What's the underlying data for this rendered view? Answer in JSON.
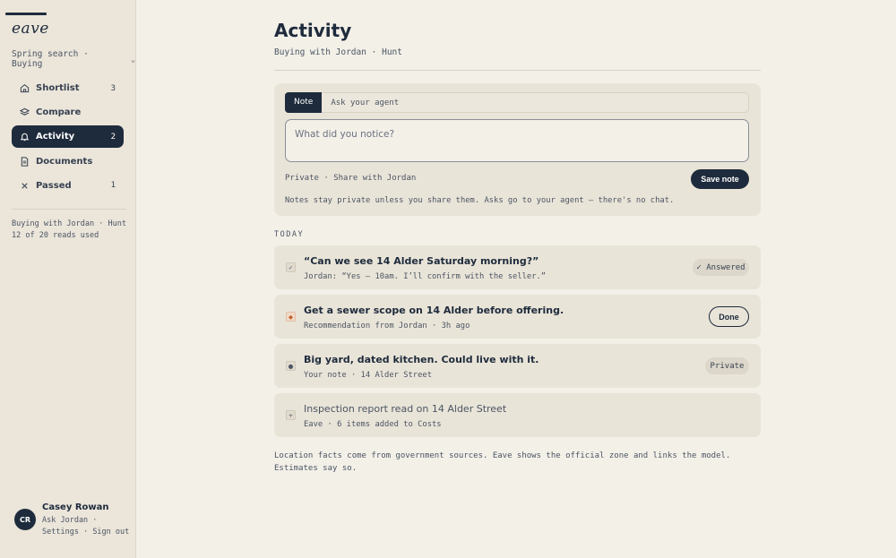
{
  "sidebar": {
    "logo": "eave",
    "context": "Spring search · Buying",
    "nav": [
      {
        "label": "Shortlist",
        "count": "3",
        "icon": "home-icon"
      },
      {
        "label": "Compare",
        "count": "",
        "icon": "layers-icon"
      },
      {
        "label": "Activity",
        "count": "2",
        "icon": "bell-icon",
        "active": true
      },
      {
        "label": "Documents",
        "count": "",
        "icon": "document-icon"
      },
      {
        "label": "Passed",
        "count": "1",
        "icon": "close-icon"
      }
    ],
    "info_line1": "Buying with Jordan · Hunt",
    "info_line2": "12 of 20 reads used",
    "user": {
      "initials": "CR",
      "name": "Casey Rowan",
      "link_ask": "Ask Jordan",
      "link_settings": "Settings",
      "link_signout": "Sign out"
    }
  },
  "main": {
    "title": "Activity",
    "subtitle": "Buying with Jordan · Hunt",
    "composer": {
      "tab_note": "Note",
      "tab_ask": "Ask your agent",
      "placeholder": "What did you notice?",
      "privacy_private": "Private",
      "privacy_share": "Share with Jordan",
      "save_label": "Save note",
      "hint": "Notes stay private unless you share them. Asks go to your agent — there's no chat."
    },
    "section_today": "TODAY",
    "items": [
      {
        "marker": "✓",
        "title": "“Can we see 14 Alder Saturday morning?”",
        "sub": "Jordan: “Yes — 10am. I’ll confirm with the seller.”",
        "badge": "✓ Answered"
      },
      {
        "marker": "◆",
        "title": "Get a sewer scope on 14 Alder before offering.",
        "sub": "Recommendation from Jordan · 3h ago",
        "action": "Done"
      },
      {
        "marker": "●",
        "title": "Big yard, dated kitchen. Could live with it.",
        "sub": "Your note · 14 Alder Street",
        "badge": "Private"
      },
      {
        "marker": "+",
        "title": "Inspection report read on 14 Alder Street",
        "sub": "Eave · 6 items added to Costs"
      }
    ],
    "footnote": "Location facts come from government sources. Eave shows the official zone and links the model. Estimates say so."
  },
  "colors": {
    "navy": "#1e2b3c",
    "background": "#f3f0e8",
    "sidebar": "#ebe5da",
    "card": "#e9e4d8",
    "recommendation_marker": "#c2622d"
  }
}
